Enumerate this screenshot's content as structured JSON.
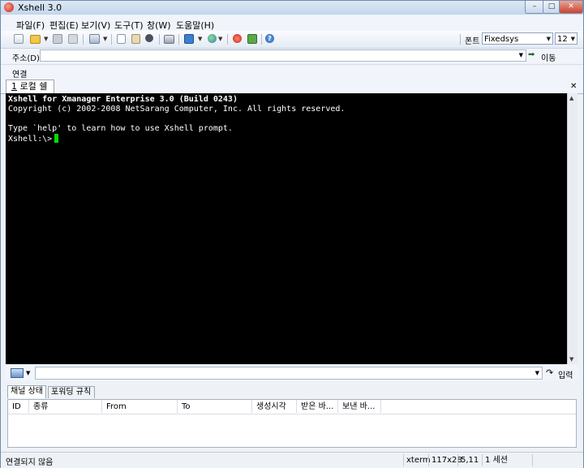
{
  "window": {
    "title": "Xshell 3.0"
  },
  "menu": [
    "파일(F)",
    "편집(E)",
    "보기(V)",
    "도구(T)",
    "창(W)",
    "도움말(H)"
  ],
  "toolbar": {
    "font_label": "폰트",
    "font_value": "Fixedsys",
    "size_value": "12",
    "icons": [
      "new-session-icon",
      "open-folder-icon",
      "reconnect-icon",
      "disconnect-icon",
      "properties-icon",
      "copy-icon",
      "paste-icon",
      "find-icon",
      "print-icon",
      "transfer-icon",
      "globe-icon",
      "xftp-icon",
      "script-icon",
      "help-icon"
    ]
  },
  "address": {
    "label": "주소(D)",
    "value": "",
    "go_label": "이동"
  },
  "links": {
    "label": "연결"
  },
  "session_tab": {
    "index": "1",
    "label": "로컬 쉘"
  },
  "terminal": {
    "lines": [
      "Xshell for Xmanager Enterprise 3.0 (Build 0243)",
      "Copyright (c) 2002-2008 NetSarang Computer, Inc. All rights reserved.",
      "",
      "Type `help' to learn how to use Xshell prompt.",
      "Xshell:\\>"
    ]
  },
  "command": {
    "value": "",
    "send_label": "입력"
  },
  "bottom_tabs": [
    "채널 상태",
    "포워딩 규칙"
  ],
  "channel_table": {
    "columns": [
      "ID",
      "종류",
      "From",
      "To",
      "생성시각",
      "받은 바...",
      "보낸 바..."
    ]
  },
  "status": {
    "text": "연결되지 않음",
    "term": "xterm",
    "size": "117x28",
    "pos": "5,11",
    "sessions": "1 세션"
  },
  "colors": {
    "terminal_bg": "#000000",
    "terminal_fg": "#ffffff",
    "cursor": "#00e000",
    "frame": "#6f8aa8"
  }
}
